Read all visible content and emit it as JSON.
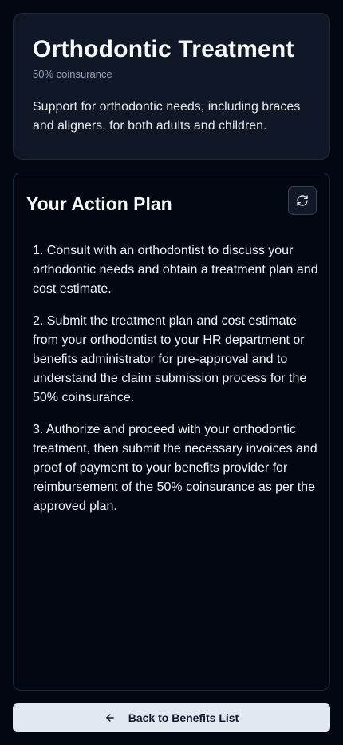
{
  "benefit": {
    "title": "Orthodontic Treatment",
    "coverage": "50% coinsurance",
    "description": "Support for orthodontic needs, including braces and aligners, for both adults and children."
  },
  "action_plan": {
    "title": "Your Action Plan",
    "refresh_icon": "refresh-icon",
    "steps": [
      "1. Consult with an orthodontist to discuss your orthodontic needs and obtain a treatment plan and cost estimate.",
      "2. Submit the treatment plan and cost estimate from your orthodontist to your HR department or benefits administrator for pre-approval and to understand the claim submission process for the 50% coinsurance.",
      "3. Authorize and proceed with your orthodontic treatment, then submit the necessary invoices and proof of payment to your benefits provider for reimbursement of the 50% coinsurance as per the approved plan."
    ]
  },
  "footer": {
    "back_label": "Back to Benefits List",
    "back_icon": "arrow-left-icon"
  },
  "colors": {
    "background": "#030712",
    "card": "#101827",
    "button_bg": "#e2e8f0",
    "muted_text": "#94a3b8"
  }
}
